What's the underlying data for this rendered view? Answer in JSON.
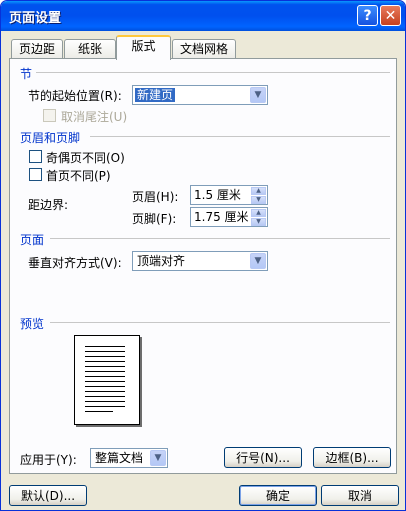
{
  "window": {
    "title": "页面设置",
    "help_icon": "?",
    "close_icon": "✕"
  },
  "tabs": [
    {
      "label": "页边距"
    },
    {
      "label": "纸张"
    },
    {
      "label": "版式",
      "active": true
    },
    {
      "label": "文档网格"
    }
  ],
  "section_section": {
    "title": "节",
    "start_label": "节的起始位置(R):",
    "start_value": "新建页",
    "suppress_endnotes_label": "取消尾注(U)",
    "suppress_endnotes_checked": false,
    "suppress_endnotes_disabled": true
  },
  "headers_footers": {
    "title": "页眉和页脚",
    "odd_even_label": "奇偶页不同(O)",
    "odd_even_checked": false,
    "first_page_label": "首页不同(P)",
    "first_page_checked": false,
    "from_edge_label": "距边界:",
    "header_label": "页眉(H):",
    "header_value": "1.5 厘米",
    "footer_label": "页脚(F):",
    "footer_value": "1.75 厘米"
  },
  "page": {
    "title": "页面",
    "vertical_align_label": "垂直对齐方式(V):",
    "vertical_align_value": "顶端对齐"
  },
  "preview": {
    "title": "预览"
  },
  "bottom": {
    "apply_to_label": "应用于(Y):",
    "apply_to_value": "整篇文档",
    "line_numbers_button": "行号(N)...",
    "borders_button": "边框(B)..."
  },
  "footer": {
    "default_button": "默认(D)...",
    "ok_button": "确定",
    "cancel_button": "取消"
  },
  "colors": {
    "accent": "#0033cc",
    "titlebar": "#0053ee",
    "selection": "#316ac5"
  }
}
